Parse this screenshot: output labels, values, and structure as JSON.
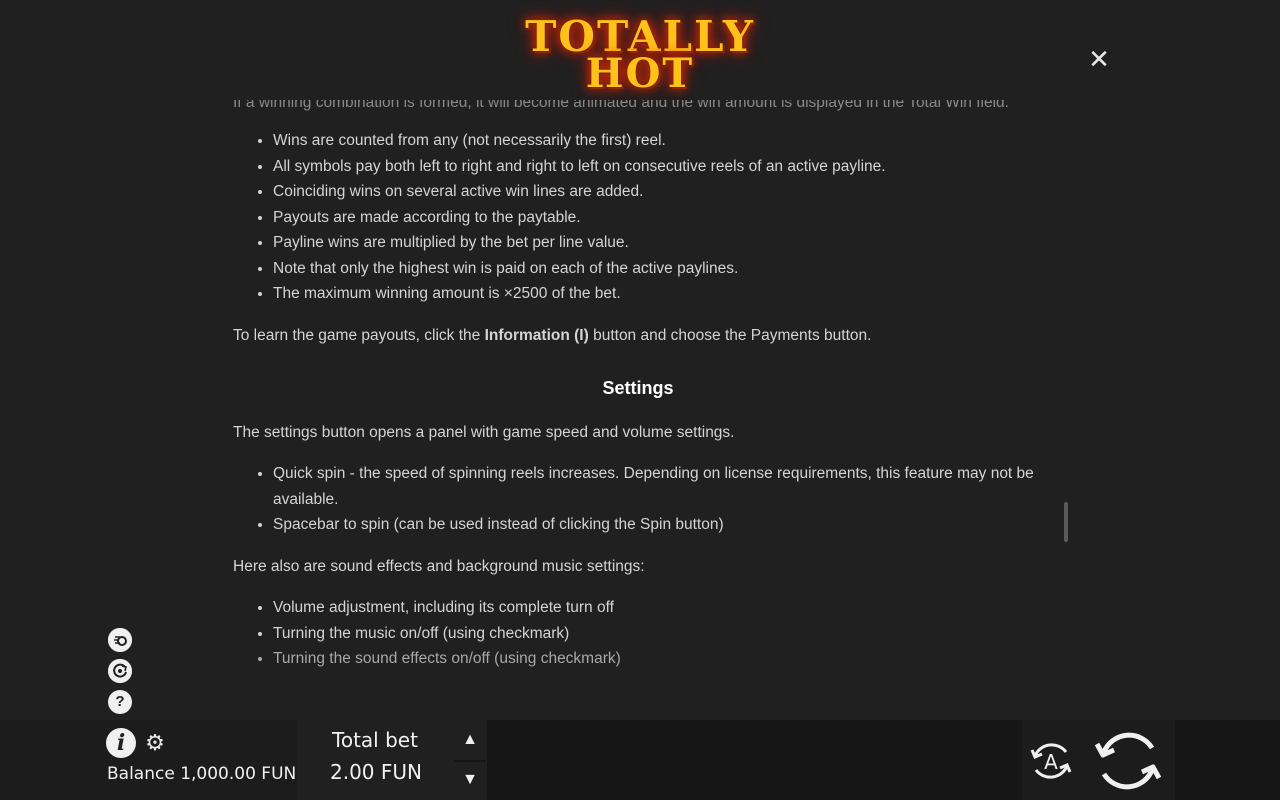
{
  "logo": {
    "line1": "TOTALLY",
    "line2": "HOT"
  },
  "close_icon": "close-icon",
  "rules": {
    "cut_line": "If a winning combination is formed, it will become animated and the win amount is displayed in the Total Win field.",
    "wins": [
      "Wins are counted from any (not necessarily the first) reel.",
      "All symbols pay both left to right and right to left on consecutive reels of an active payline.",
      "Coinciding wins on several active win lines are added.",
      "Payouts are made according to the paytable.",
      "Payline wins are multiplied by the bet per line value.",
      "Note that only the highest win is paid on each of the active paylines.",
      "The maximum winning amount is ×2500 of the bet."
    ],
    "payouts_pre": "To learn the game payouts, click the ",
    "payouts_bold": "Information (I)",
    "payouts_post": " button and choose the Payments button.",
    "settings_title": "Settings",
    "settings_intro": "The settings button opens a panel with game speed and volume settings.",
    "settings_items": [
      "Quick spin - the speed of spinning reels increases. Depending on license requirements, this feature may not be available.",
      "Spacebar to spin (can be used instead of clicking the Spin button)"
    ],
    "sound_intro": "Here also are sound effects and background music settings:",
    "sound_items": [
      "Volume adjustment, including its complete turn off",
      "Turning the music on/off (using checkmark)",
      "Turning the sound effects on/off (using checkmark)"
    ]
  },
  "bottom": {
    "balance": "Balance 1,000.00 FUN",
    "total_bet_label": "Total bet",
    "total_bet_value": "2.00 FUN",
    "auto_letter": "A"
  },
  "colors": {
    "background": "#202020",
    "text": "#d4d4d4",
    "logo_gold": "#ffc21a",
    "logo_glow": "#ff3300"
  }
}
